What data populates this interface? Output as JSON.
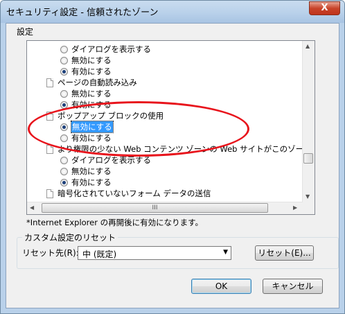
{
  "window": {
    "title": "セキュリティ設定 - 信頼されたゾーン",
    "close_glyph": "X"
  },
  "settings_label": "設定",
  "list": {
    "items": [
      {
        "kind": "radio",
        "label": "ダイアログを表示する",
        "checked": false
      },
      {
        "kind": "radio",
        "label": "無効にする",
        "checked": false
      },
      {
        "kind": "radio",
        "label": "有効にする",
        "checked": true
      },
      {
        "kind": "heading",
        "label": "ページの自動読み込み"
      },
      {
        "kind": "radio",
        "label": "無効にする",
        "checked": false
      },
      {
        "kind": "radio",
        "label": "有効にする",
        "checked": true
      },
      {
        "kind": "heading",
        "label": "ポップアップ ブロックの使用"
      },
      {
        "kind": "radio",
        "label": "無効にする",
        "checked": true,
        "selected": true
      },
      {
        "kind": "radio",
        "label": "有効にする",
        "checked": false
      },
      {
        "kind": "heading",
        "label": "より権限の少ない Web コンテンツ ゾーンの Web サイトがこのゾーンに移動で"
      },
      {
        "kind": "radio",
        "label": "ダイアログを表示する",
        "checked": false
      },
      {
        "kind": "radio",
        "label": "無効にする",
        "checked": false
      },
      {
        "kind": "radio",
        "label": "有効にする",
        "checked": true
      },
      {
        "kind": "heading",
        "label": "暗号化されていないフォーム データの送信"
      }
    ],
    "hscroll_grip": "III"
  },
  "restart_note": "*Internet Explorer の再開後に有効になります。",
  "custom_reset": {
    "group_label": "カスタム設定のリセット",
    "reset_to_label": "リセット先(R):",
    "dropdown_value": "中 (既定)",
    "reset_button": "リセット(E)..."
  },
  "buttons": {
    "ok": "OK",
    "cancel": "キャンセル"
  },
  "colors": {
    "annotation_ellipse": "#e8141c",
    "selection": "#3399ff"
  }
}
